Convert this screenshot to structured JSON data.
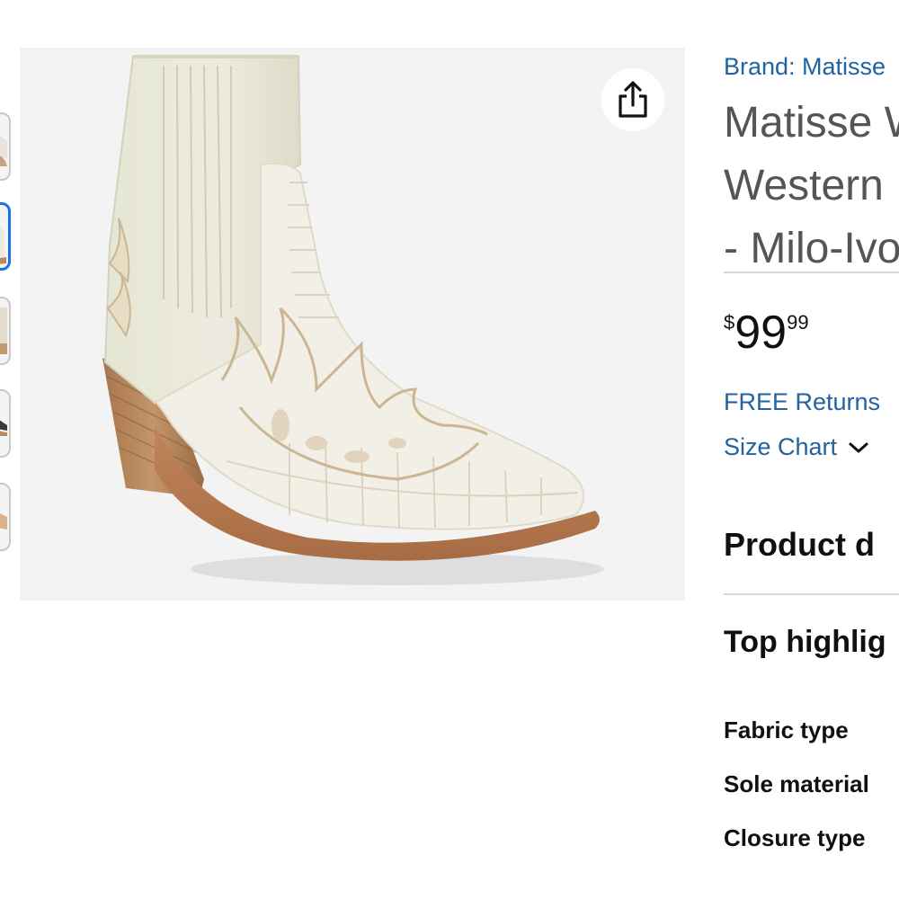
{
  "product": {
    "brand_link": "Brand: Matisse",
    "title_lines": [
      "Matisse W",
      "Western",
      "- Milo-Ivo"
    ],
    "price": {
      "symbol": "$",
      "whole": "99",
      "fraction": "99"
    },
    "free_returns": "FREE Returns",
    "size_chart": "Size Chart",
    "section_title": "Product d",
    "top_highlights": "Top highlig",
    "specs": [
      "Fabric type",
      "Sole material",
      "Closure type"
    ]
  },
  "gallery": {
    "thumbnail_count": 5,
    "active_thumbnail": 2
  },
  "icons": {
    "share": "share-icon",
    "size_chart_toggle": "chevron-down-icon"
  },
  "colors": {
    "link": "#2162a1",
    "active_thumb": "#1a73e8",
    "title_gray": "#555555"
  }
}
